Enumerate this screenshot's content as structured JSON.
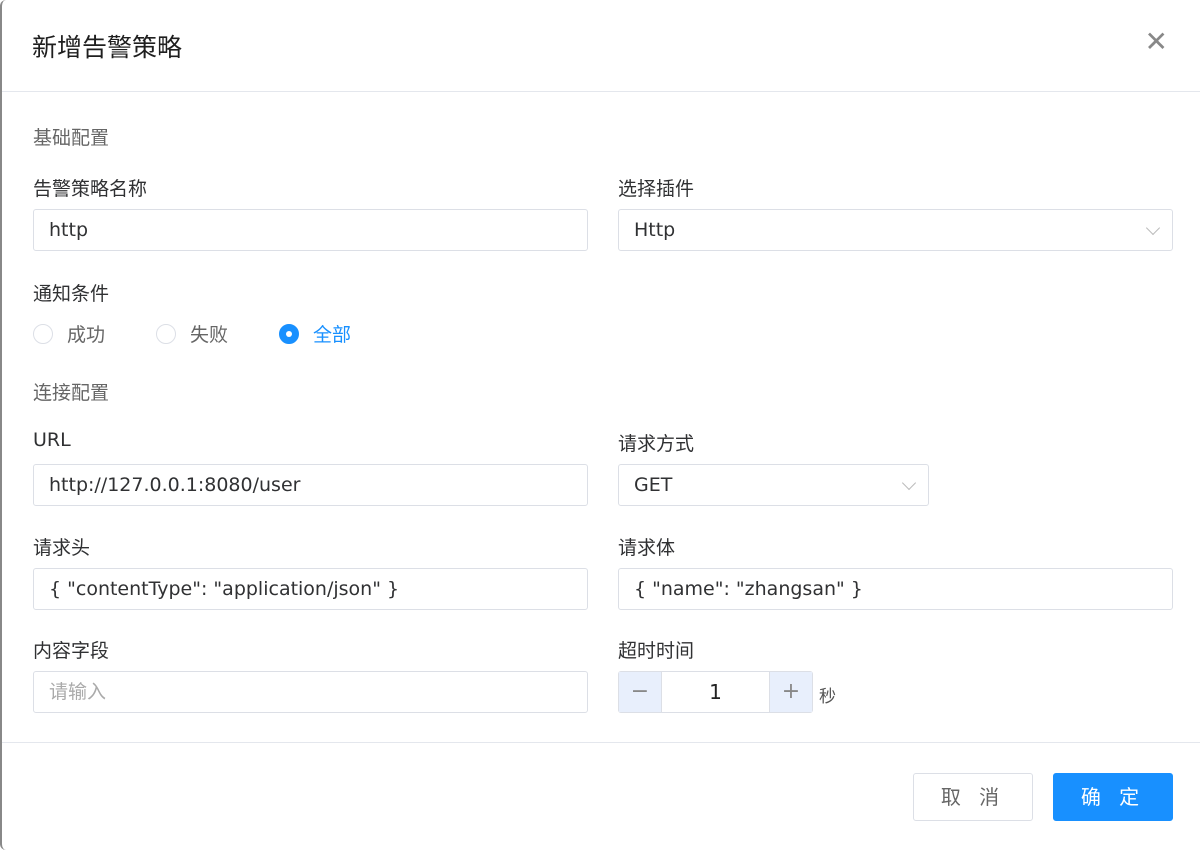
{
  "dialog": {
    "title": "新增告警策略",
    "close_icon": "close-icon"
  },
  "basic": {
    "section": "基础配置",
    "name_label": "告警策略名称",
    "name_value": "http",
    "plugin_label": "选择插件",
    "plugin_value": "Http",
    "notify_label": "通知条件",
    "notify_options": [
      "成功",
      "失败",
      "全部"
    ],
    "notify_selected": "全部"
  },
  "conn": {
    "section": "连接配置",
    "url_label": "URL",
    "url_value": "http://127.0.0.1:8080/user",
    "method_label": "请求方式",
    "method_value": "GET",
    "headers_label": "请求头",
    "headers_value": "{ \"contentType\": \"application/json\" }",
    "body_label": "请求体",
    "body_value": "{ \"name\": \"zhangsan\" }",
    "content_label": "内容字段",
    "content_placeholder": "请输入",
    "timeout_label": "超时时间",
    "timeout_value": "1",
    "timeout_unit": "秒",
    "minus": "−",
    "plus": "+"
  },
  "footer": {
    "cancel": "取 消",
    "ok": "确 定"
  }
}
